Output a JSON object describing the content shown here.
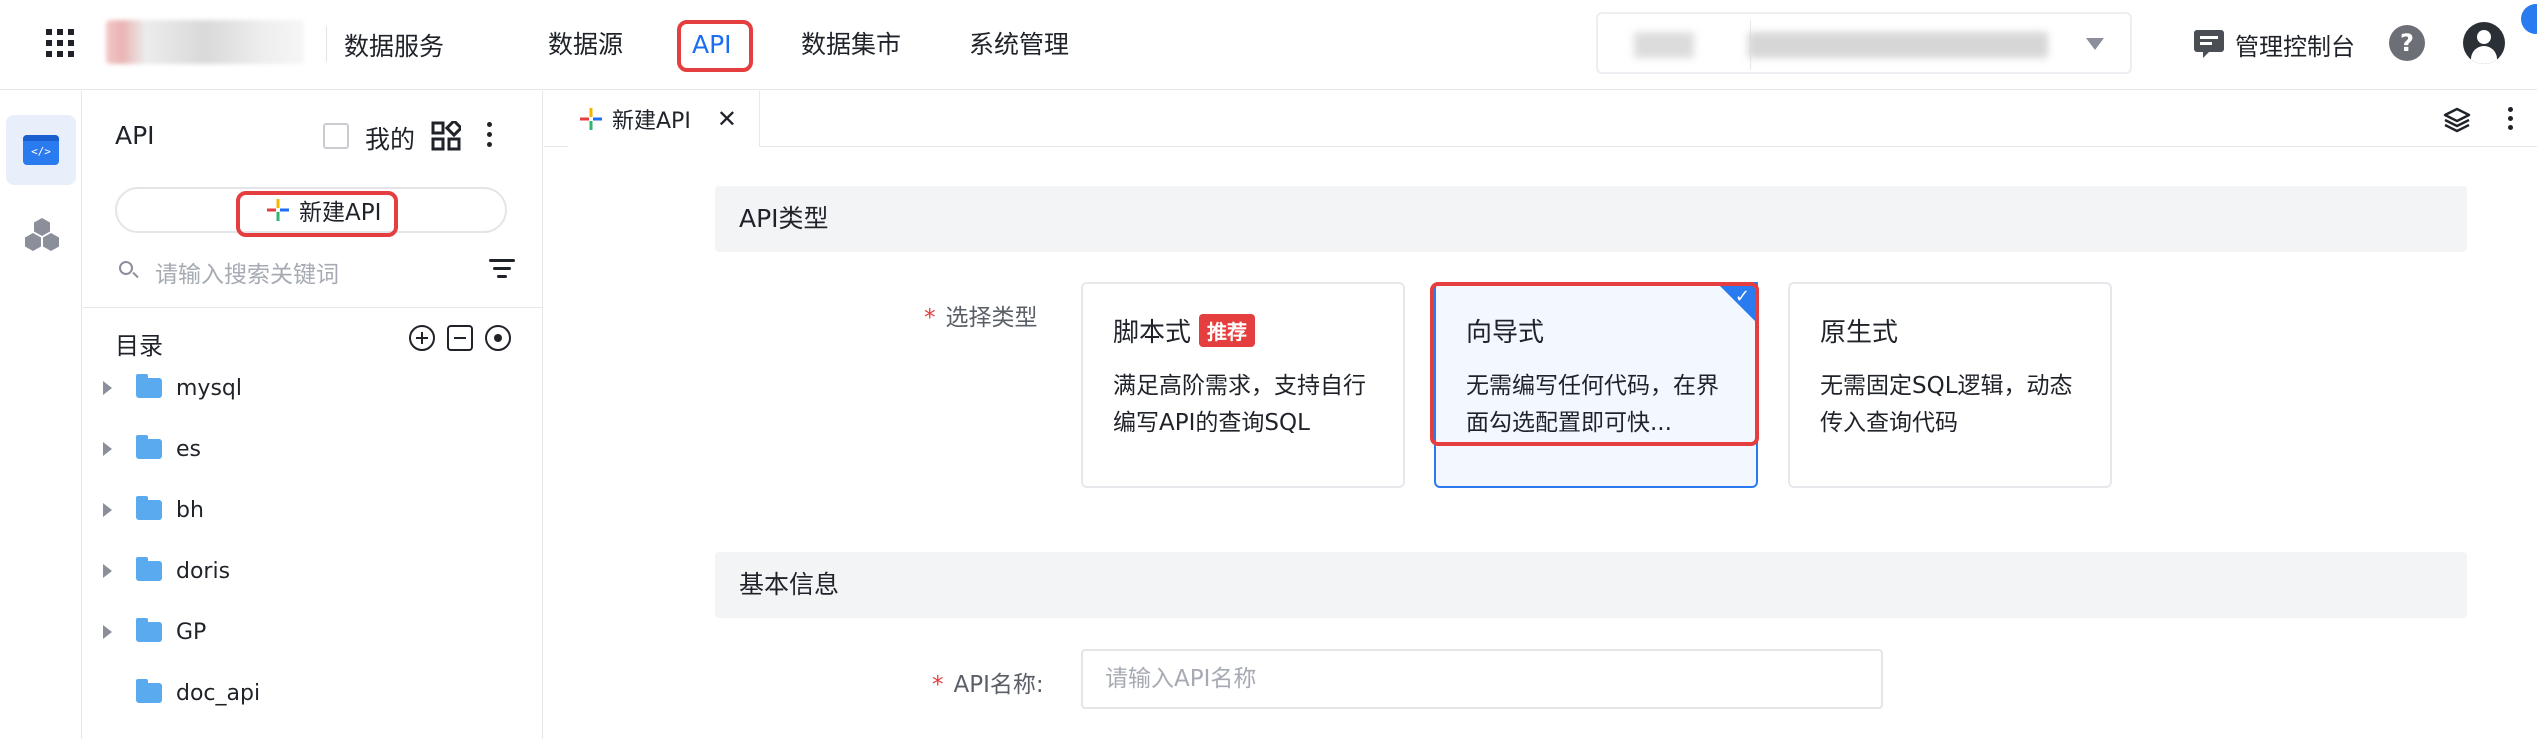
{
  "topbar": {
    "product_name": "数据服务",
    "nav": [
      {
        "label": "数据源"
      },
      {
        "label": "API"
      },
      {
        "label": "数据集市"
      },
      {
        "label": "系统管理"
      }
    ],
    "active_nav": "API",
    "console_label": "管理控制台",
    "help_label": "?"
  },
  "sidebar": {
    "title": "API",
    "mine_label": "我的",
    "new_api_label": "新建API",
    "search_placeholder": "请输入搜索关键词",
    "tree_title": "目录",
    "tree_items": [
      {
        "label": "mysql",
        "expandable": true
      },
      {
        "label": "es",
        "expandable": true
      },
      {
        "label": "bh",
        "expandable": true
      },
      {
        "label": "doris",
        "expandable": true
      },
      {
        "label": "GP",
        "expandable": true
      },
      {
        "label": "doc_api",
        "expandable": false
      }
    ]
  },
  "tabs": [
    {
      "label": "新建API",
      "close": "✕"
    }
  ],
  "main": {
    "section_api_type": "API类型",
    "select_type_label": "选择类型",
    "cards": [
      {
        "title": "脚本式",
        "badge": "推荐",
        "desc": "满足高阶需求，支持自行编写API的查询SQL",
        "selected": false
      },
      {
        "title": "向导式",
        "badge": "",
        "desc": "无需编写任何代码，在界面勾选配置即可快...",
        "selected": true
      },
      {
        "title": "原生式",
        "badge": "",
        "desc": "无需固定SQL逻辑，动态传入查询代码",
        "selected": false
      }
    ],
    "section_basic": "基本信息",
    "api_name_label": "API名称:",
    "api_name_placeholder": "请输入API名称",
    "required_mark": "*"
  },
  "colors": {
    "accent": "#1b6ef3",
    "highlight": "#e53e3e",
    "folder": "#5aaaf0"
  }
}
